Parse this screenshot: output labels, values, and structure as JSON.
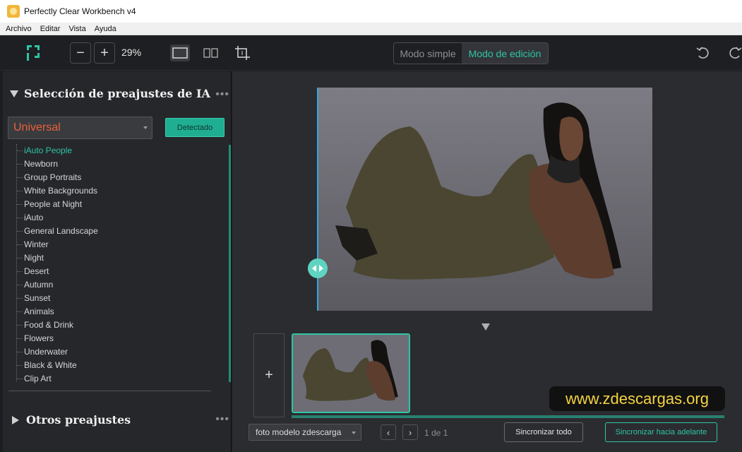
{
  "window": {
    "title": "Perfectly Clear Workbench v4"
  },
  "menu": {
    "items": [
      "Archivo",
      "Editar",
      "Vista",
      "Ayuda"
    ]
  },
  "toolbar": {
    "zoom_out_label": "−",
    "zoom_in_label": "+",
    "zoom_level": "29%",
    "mode_simple": "Modo simple",
    "mode_edit": "Modo de edición"
  },
  "ai_presets": {
    "title": "Selección de preajustes de IA",
    "menu_dots": "•••",
    "selected_group": "Universal",
    "detected_button": "Detectado",
    "items": [
      "iAuto People",
      "Newborn",
      "Group Portraits",
      "White Backgrounds",
      "People at Night",
      "iAuto",
      "General Landscape",
      "Winter",
      "Night",
      "Desert",
      "Autumn",
      "Sunset",
      "Animals",
      "Food & Drink",
      "Flowers",
      "Underwater",
      "Black & White",
      "Clip Art"
    ],
    "selected_index": 0
  },
  "other_presets": {
    "title": "Otros preajustes",
    "menu_dots": "•••"
  },
  "filmstrip": {
    "add_label": "+",
    "file_name": "foto modelo zdescarga",
    "page_indicator": "1 de 1",
    "prev_label": "‹",
    "next_label": "›",
    "sync_all": "Sincronizar todo",
    "sync_forward": "Sincronizar hacia adelante"
  },
  "watermark": "www.zdescargas.org",
  "colors": {
    "accent": "#2ec4a6",
    "preset_group": "#e9613a",
    "watermark": "#f4d341"
  }
}
